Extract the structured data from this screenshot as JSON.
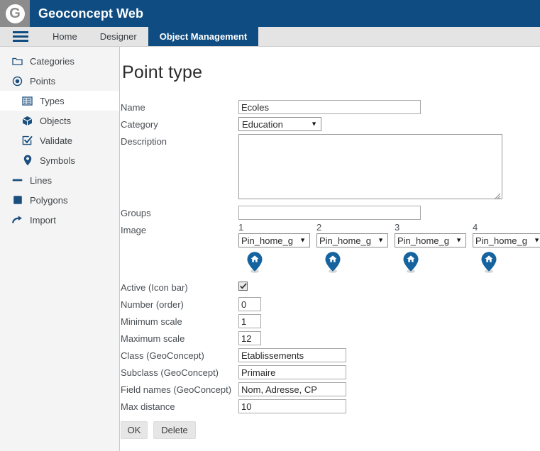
{
  "brand": {
    "logo_letter": "G",
    "title": "Geoconcept Web",
    "logo_icon": "geoconcept-g-logo",
    "bar_color": "#0f4c81",
    "logo_bg": "#8c8c8c"
  },
  "tabs": {
    "menu_icon": "hamburger-menu-icon",
    "items": [
      {
        "label": "Home",
        "active": false
      },
      {
        "label": "Designer",
        "active": false
      },
      {
        "label": "Object Management",
        "active": true
      }
    ]
  },
  "sidebar": {
    "items": [
      {
        "label": "Categories",
        "icon": "folder-icon",
        "active": false,
        "child": false
      },
      {
        "label": "Points",
        "icon": "point-target-icon",
        "active": false,
        "child": false
      },
      {
        "label": "Types",
        "icon": "list-table-icon",
        "active": true,
        "child": true
      },
      {
        "label": "Objects",
        "icon": "cube-box-icon",
        "active": false,
        "child": true
      },
      {
        "label": "Validate",
        "icon": "checkbox-check-icon",
        "active": false,
        "child": true
      },
      {
        "label": "Symbols",
        "icon": "map-pin-icon",
        "active": false,
        "child": true
      },
      {
        "label": "Lines",
        "icon": "line-dash-icon",
        "active": false,
        "child": false
      },
      {
        "label": "Polygons",
        "icon": "filled-square-icon",
        "active": false,
        "child": false
      },
      {
        "label": "Import",
        "icon": "arrow-import-icon",
        "active": false,
        "child": false
      }
    ]
  },
  "main": {
    "page_title": "Point type",
    "labels": {
      "name": "Name",
      "category": "Category",
      "description": "Description",
      "groups": "Groups",
      "image": "Image",
      "active": "Active (Icon bar)",
      "number": "Number (order)",
      "min_scale": "Minimum scale",
      "max_scale": "Maximum scale",
      "class": "Class (GeoConcept)",
      "subclass": "Subclass (GeoConcept)",
      "field_names": "Field names (GeoConcept)",
      "max_distance": "Max distance"
    },
    "values": {
      "name": "Ecoles",
      "category": "Education",
      "description": "",
      "groups": "",
      "active": true,
      "number": "0",
      "min_scale": "1",
      "max_scale": "12",
      "class": "Etablissements",
      "subclass": "Primaire",
      "field_names": "Nom, Adresse, CP",
      "max_distance": "10"
    },
    "images": [
      {
        "index": "1",
        "value": "Pin_home_g",
        "icon": "map-pin-home-icon"
      },
      {
        "index": "2",
        "value": "Pin_home_g",
        "icon": "map-pin-home-icon"
      },
      {
        "index": "3",
        "value": "Pin_home_g",
        "icon": "map-pin-home-icon"
      },
      {
        "index": "4",
        "value": "Pin_home_g",
        "icon": "map-pin-home-icon"
      }
    ],
    "buttons": {
      "ok": "OK",
      "delete": "Delete"
    },
    "pin_color": "#15639f"
  }
}
